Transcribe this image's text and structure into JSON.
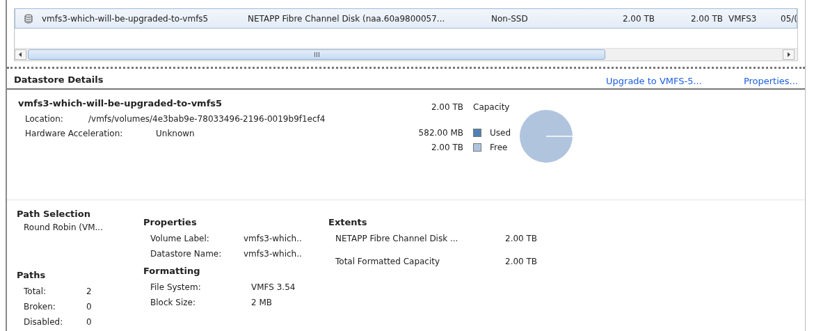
{
  "datastores": {
    "rows": [
      {
        "selected": true,
        "cells": [
          "vmfs3-which-will-be-upgraded-to-vmfs5",
          "NETAPP Fibre Channel Disk (naa.60a9800057...",
          "Non-SSD",
          "2.00 TB",
          "2.00 TB",
          "VMFS3",
          "05/("
        ]
      }
    ]
  },
  "details": {
    "title": "Datastore Details",
    "links": [
      "Upgrade to VMFS-5...",
      "Properties..."
    ],
    "name": "vmfs3-which-will-be-upgraded-to-vmfs5",
    "fields": [
      {
        "label": "Location:",
        "value": "/vmfs/volumes/4e3bab9e-78033496-2196-0019b9f1ecf4"
      },
      {
        "label": "Hardware Acceleration:",
        "value": "Unknown"
      }
    ],
    "capacity": {
      "value": "2.00 TB",
      "label": "Capacity"
    },
    "legend": [
      {
        "value": "582.00 MB",
        "label": "Used",
        "color": "#4f81b5"
      },
      {
        "value": "2.00 TB",
        "label": "Free",
        "color": "#b0c4de"
      }
    ]
  },
  "path_selection": {
    "title": "Path Selection",
    "value": "Round Robin (VM..."
  },
  "paths": {
    "title": "Paths",
    "items": [
      {
        "label": "Total:",
        "value": "2"
      },
      {
        "label": "Broken:",
        "value": "0"
      },
      {
        "label": "Disabled:",
        "value": "0"
      }
    ]
  },
  "properties": {
    "title": "Properties",
    "items": [
      {
        "label": "Volume Label:",
        "value": "vmfs3-which.."
      },
      {
        "label": "Datastore Name:",
        "value": "vmfs3-which.."
      }
    ]
  },
  "formatting": {
    "title": "Formatting",
    "items": [
      {
        "label": "File System:",
        "value": "VMFS 3.54"
      },
      {
        "label": "Block Size:",
        "value": "2 MB"
      }
    ]
  },
  "extents": {
    "title": "Extents",
    "items": [
      {
        "label": "NETAPP Fibre Channel Disk ...",
        "value": "2.00 TB"
      },
      {
        "label": "Total Formatted Capacity",
        "value": "2.00 TB"
      }
    ]
  }
}
